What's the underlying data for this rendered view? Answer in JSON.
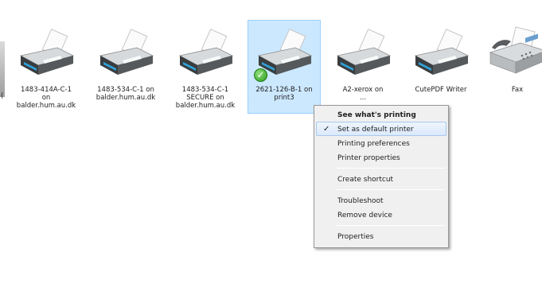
{
  "devices": [
    {
      "label": "1483-414A-C-1\non\nbalder.hum.au.dk",
      "icon": "printer-icon"
    },
    {
      "label": "1483-534-C-1 on\nbalder.hum.au.dk",
      "icon": "printer-icon"
    },
    {
      "label": "1483-534-C-1\nSECURE on\nbalder.hum.au.dk",
      "icon": "printer-icon"
    },
    {
      "label": "2621-126-B-1 on\nprint3",
      "icon": "printer-icon",
      "default_badge": "✓",
      "selected": true
    },
    {
      "label": "A2-xerox on\n...",
      "icon": "printer-icon"
    },
    {
      "label": "CutePDF Writer",
      "icon": "printer-icon"
    },
    {
      "label": "Fax",
      "icon": "fax-icon"
    }
  ],
  "edge_char": "(",
  "context_menu": {
    "items": [
      {
        "label": "See what's printing",
        "bold": true
      },
      {
        "label": "Set as default printer",
        "checked": true,
        "check_glyph": "✓"
      },
      {
        "label": "Printing preferences"
      },
      {
        "label": "Printer properties"
      },
      {
        "label": "Create shortcut"
      },
      {
        "label": "Troubleshoot"
      },
      {
        "label": "Remove device"
      },
      {
        "label": "Properties"
      }
    ]
  },
  "colors": {
    "selection_fill": "#cce8ff",
    "selection_border": "#99d1ff",
    "menu_background": "#f0f0f0",
    "check_green": "#2e9b1e"
  }
}
